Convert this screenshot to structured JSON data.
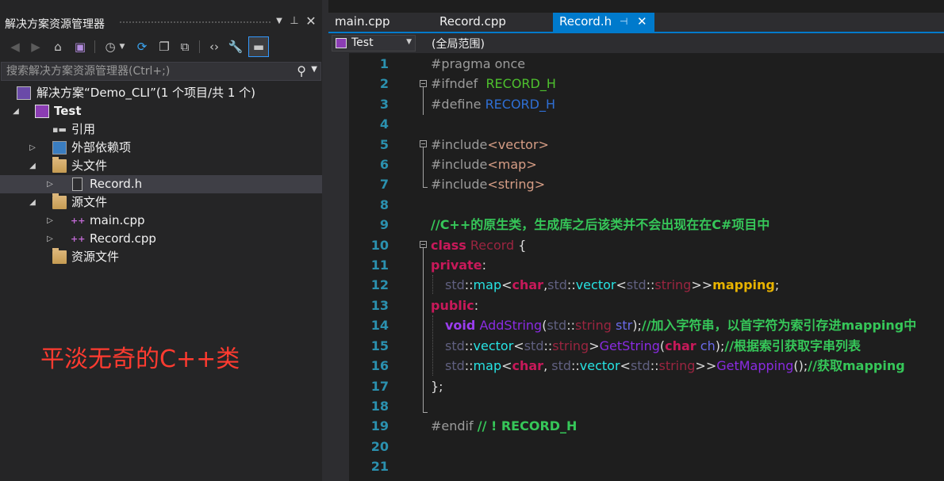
{
  "solution_explorer": {
    "title": "解决方案资源管理器",
    "search_placeholder": "搜索解决方案资源管理器(Ctrl+;)",
    "tree": {
      "solution": "解决方案“Demo_CLI”(1 个项目/共 1 个)",
      "project": "Test",
      "references": "引用",
      "external_deps": "外部依赖项",
      "header_files": "头文件",
      "record_h": "Record.h",
      "source_files": "源文件",
      "main_cpp": "main.cpp",
      "record_cpp": "Record.cpp",
      "resource_files": "资源文件"
    }
  },
  "annotation": "平淡无奇的C++类",
  "tabs": [
    {
      "label": "main.cpp",
      "active": false
    },
    {
      "label": "Record.cpp",
      "active": false
    },
    {
      "label": "Record.h",
      "active": true
    }
  ],
  "navigation": {
    "project_scope": "Test",
    "member_scope": "(全局范围)"
  },
  "editor": {
    "line_numbers": [
      "1",
      "2",
      "3",
      "4",
      "5",
      "6",
      "7",
      "8",
      "9",
      "10",
      "11",
      "12",
      "13",
      "14",
      "15",
      "16",
      "17",
      "18",
      "19",
      "20",
      "21"
    ],
    "code": {
      "l1": "#pragma once",
      "l2_a": "#ifndef",
      "l2_b": "RECORD_H",
      "l3_a": "#define",
      "l3_b": "RECORD_H",
      "l5_a": "#include",
      "l5_b": "<vector>",
      "l6_a": "#include",
      "l6_b": "<map>",
      "l7_a": "#include",
      "l7_b": "<string>",
      "l9": "//C++的原生类，生成库之后该类并不会出现在在C#项目中",
      "l10_a": "class",
      "l10_b": "Record",
      "l10_c": "{",
      "l11": "private",
      "l12_std1": "std",
      "l12_map": "map",
      "l12_char": "char",
      "l12_std2": "std",
      "l12_vector": "vector",
      "l12_std3": "std",
      "l12_string": "string",
      "l12_mapping": "mapping",
      "l13": "public",
      "l14_void": "void",
      "l14_fn": "AddString",
      "l14_std": "std",
      "l14_string": "string",
      "l14_param": "str",
      "l14_cm": "//加入字符串，以首字符为索引存进mapping中",
      "l15_std1": "std",
      "l15_vector": "vector",
      "l15_std2": "std",
      "l15_string": "string",
      "l15_fn": "GetString",
      "l15_char": "char",
      "l15_param": "ch",
      "l15_cm": "//根据索引获取字串列表",
      "l16_std1": "std",
      "l16_map": "map",
      "l16_char": "char",
      "l16_std2": "std",
      "l16_vector": "vector",
      "l16_std3": "std",
      "l16_string": "string",
      "l16_fn": "GetMapping",
      "l16_cm": "//获取mapping",
      "l17": "};",
      "l19_a": "#endif",
      "l19_b": "// ! RECORD_H"
    }
  },
  "colors": {
    "accent": "#007acc",
    "annotation": "#ff3b30"
  }
}
